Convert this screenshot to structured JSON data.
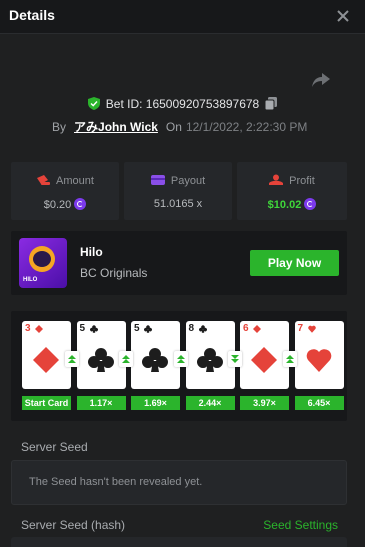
{
  "header": {
    "title": "Details"
  },
  "bet": {
    "id_text": "Bet ID: 16500920753897678",
    "by_label": "By",
    "username": "アみJohn Wick",
    "on_label": "On",
    "date": "12/1/2022, 2:22:30 PM"
  },
  "stats": {
    "amount": {
      "label": "Amount",
      "value": "$0.20"
    },
    "payout": {
      "label": "Payout",
      "value": "51.0165 x"
    },
    "profit": {
      "label": "Profit",
      "value": "$10.02"
    }
  },
  "game": {
    "name": "Hilo",
    "provider": "BC Originals",
    "thumb_text": "HILO",
    "play_label": "Play Now"
  },
  "cards": [
    {
      "rank": "3",
      "suit": "diamond",
      "color": "red",
      "label": "Start Card"
    },
    {
      "rank": "5",
      "suit": "club",
      "color": "black",
      "label": "1.17×",
      "arrow": "up"
    },
    {
      "rank": "5",
      "suit": "club",
      "color": "black",
      "label": "1.69×",
      "arrow": "up"
    },
    {
      "rank": "8",
      "suit": "club",
      "color": "black",
      "label": "2.44×",
      "arrow": "up"
    },
    {
      "rank": "6",
      "suit": "diamond",
      "color": "red",
      "label": "3.97×",
      "arrow": "down"
    },
    {
      "rank": "7",
      "suit": "heart",
      "color": "red",
      "label": "6.45×",
      "arrow": "up"
    }
  ],
  "seed": {
    "server_seed_label": "Server Seed",
    "server_seed_value": "The Seed hasn't been revealed yet.",
    "hash_label": "Server Seed (hash)",
    "settings_label": "Seed Settings"
  },
  "colors": {
    "accent": "#2bb42c",
    "background": "#1f2021",
    "panel": "#25272a",
    "card_red": "#e5433a"
  }
}
